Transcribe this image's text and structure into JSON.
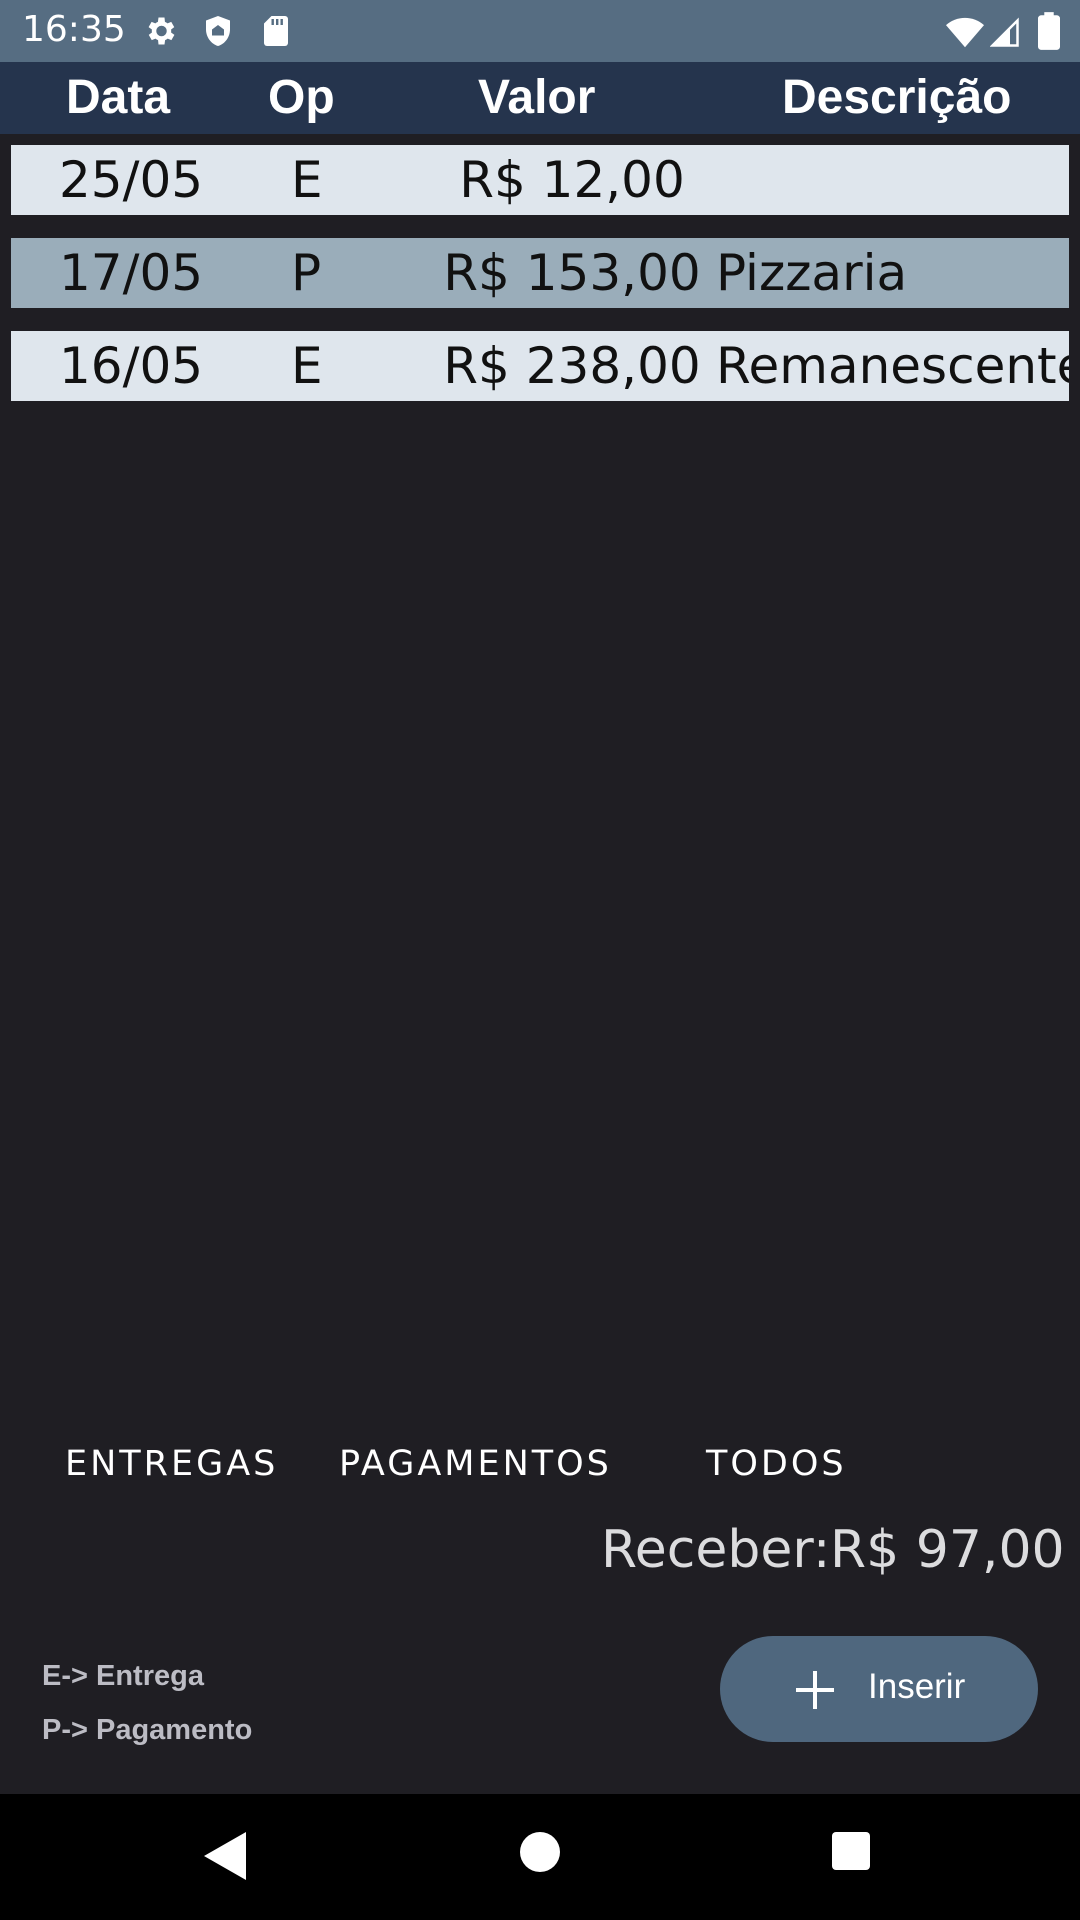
{
  "status_bar": {
    "time": "16:35",
    "icons": [
      "gear-icon",
      "shield-icon",
      "sd-card-icon",
      "wifi-icon",
      "signal-icon",
      "battery-icon"
    ]
  },
  "table": {
    "headers": {
      "date": "Data",
      "op": "Op",
      "value": "Valor",
      "description": "Descrição"
    },
    "rows": [
      {
        "date": "25/05",
        "op": "E",
        "value": "R$ 12,00",
        "description": ""
      },
      {
        "date": "17/05",
        "op": "P",
        "value": "R$ 153,00",
        "description": "Pizzaria"
      },
      {
        "date": "16/05",
        "op": "E",
        "value": "R$ 238,00",
        "description": "Remanescente"
      }
    ]
  },
  "filters": {
    "entregas": "ENTREGAS",
    "pagamentos": "PAGAMENTOS",
    "todos": "TODOS"
  },
  "summary": {
    "label": "Receber:",
    "value": "R$ 97,00"
  },
  "legend": {
    "e": "E-> Entrega",
    "p": "P-> Pagamento"
  },
  "insert_button": {
    "label": "Inserir",
    "icon": "plus-icon"
  },
  "colors": {
    "status_bar": "#566d82",
    "header": "#25344d",
    "background": "#1f1e23",
    "row_light": "#dfe6ed",
    "row_dark": "#9aadba",
    "button": "#4f677e"
  },
  "nav_bar": {
    "icons": [
      "back-icon",
      "home-icon",
      "recents-icon"
    ]
  }
}
